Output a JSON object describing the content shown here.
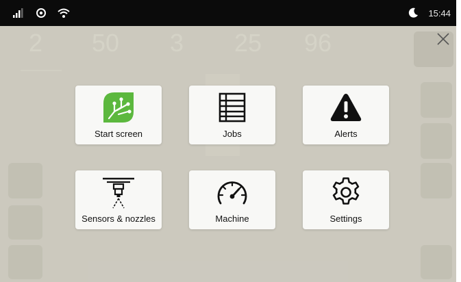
{
  "status_bar": {
    "time": "15:44",
    "icons": [
      "signal-icon",
      "location-icon",
      "wifi-icon",
      "night-mode-icon"
    ]
  },
  "background": {
    "readings": [
      "2",
      "50",
      "3",
      "25",
      "96"
    ]
  },
  "menu": {
    "tiles": [
      {
        "label": "Start screen",
        "icon": "start-screen-icon"
      },
      {
        "label": "Jobs",
        "icon": "jobs-list-icon"
      },
      {
        "label": "Alerts",
        "icon": "alert-icon"
      },
      {
        "label": "Sensors & nozzles",
        "icon": "sensor-nozzle-icon"
      },
      {
        "label": "Machine",
        "icon": "speedometer-icon"
      },
      {
        "label": "Settings",
        "icon": "gear-icon"
      }
    ]
  },
  "colors": {
    "start_icon_green": "#5cb83e",
    "tile_background": "#f8f8f6",
    "status_bar": "#0b0b0b"
  }
}
